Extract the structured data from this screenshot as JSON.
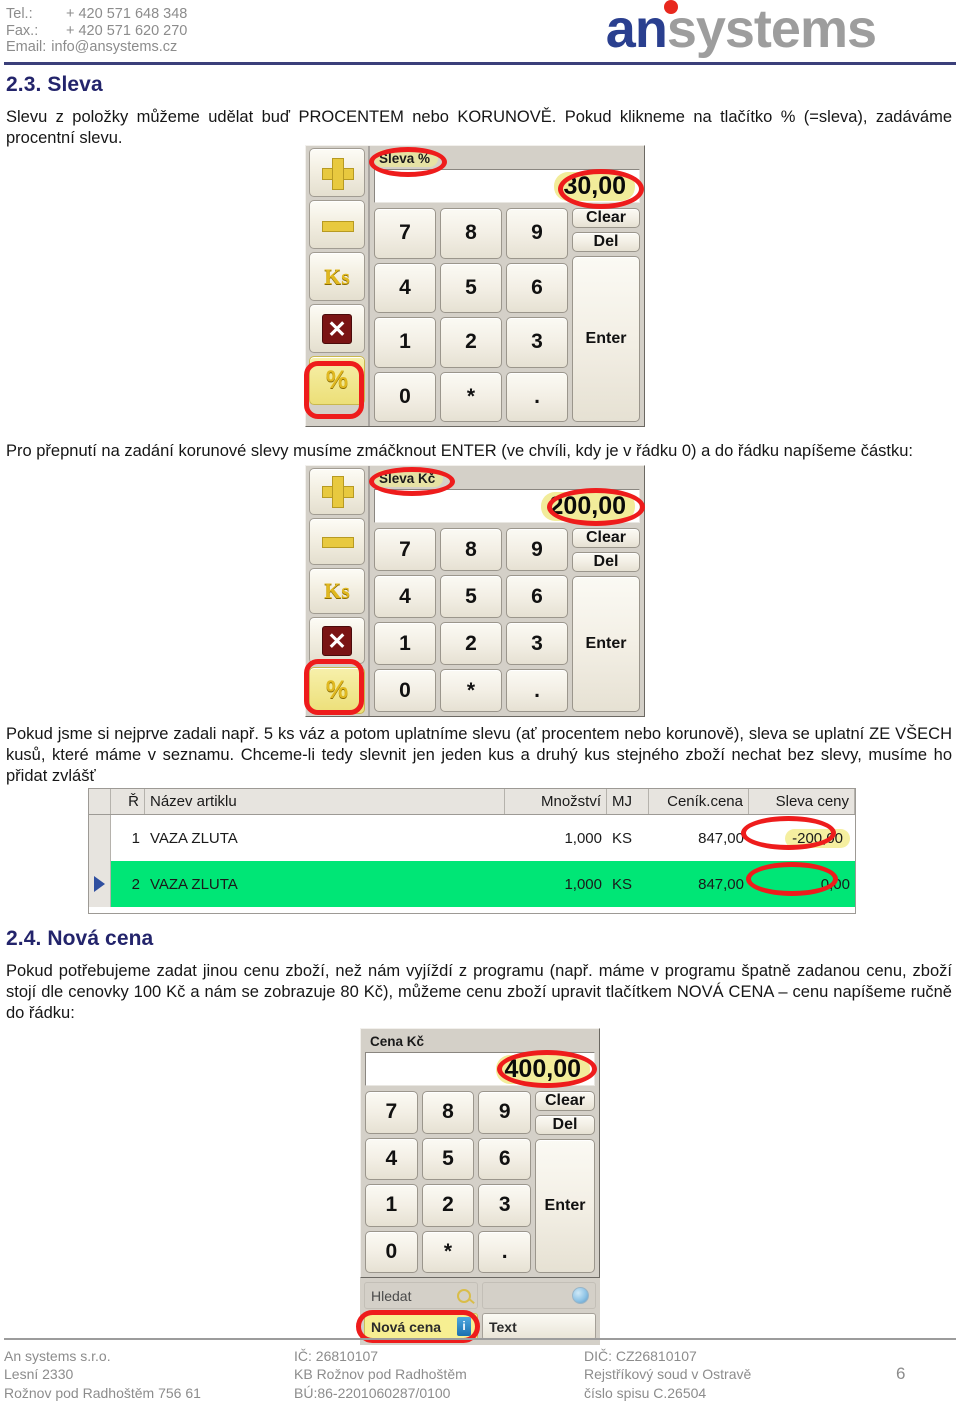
{
  "header": {
    "contact": [
      {
        "label": "Tel.:",
        "value": "+ 420 571 648 348"
      },
      {
        "label": "Fax.:",
        "value": "+ 420 571 620 270"
      },
      {
        "label": "Email:",
        "value": "info@ansystems.cz"
      }
    ],
    "logo": {
      "part1": "an",
      "part2": "systems",
      "color1": "#2a3f8f",
      "color2": "#9d9d9d",
      "dot_color": "#e8281e"
    }
  },
  "sections": [
    {
      "heading": "2.3. Sleva",
      "paragraph": "Slevu z položky můžeme udělat buď PROCENTEM nebo KORUNOVĚ. Pokud klikneme na tlačítko % (=sleva), zadáváme procentní slevu."
    },
    {
      "paragraph": "Pro přepnutí na zadání korunové slevy musíme zmáčknout ENTER (ve chvíli, kdy je v řádku 0) a do řádku napíšeme částku:"
    },
    {
      "paragraph": "Pokud jsme si nejprve zadali např. 5 ks váz a potom uplatníme slevu (ať procentem nebo korunově), sleva se uplatní ZE VŠECH kusů, které máme v seznamu. Chceme-li tedy slevnit jen jeden kus a druhý kus stejného zboží nechat bez slevy, musíme ho přidat zvlášť"
    },
    {
      "heading": "2.4. Nová cena",
      "paragraph": "Pokud potřebujeme zadat jinou cenu zboží, než nám vyjíždí z programu (např. máme v programu špatně zadanou cenu, zboží stojí dle cenovky 100 Kč a nám se zobrazuje 80 Kč), můžeme cenu zboží upravit tlačítkem NOVÁ CENA – cenu napíšeme ručně do řádku:"
    }
  ],
  "keypad_common": {
    "side_buttons": [
      {
        "name": "plus-button",
        "label": ""
      },
      {
        "name": "minus-button",
        "label": ""
      },
      {
        "name": "ks-button",
        "label": "Ks"
      },
      {
        "name": "delete-button",
        "label": "✕"
      },
      {
        "name": "percent-button",
        "label": "%"
      }
    ],
    "keys": [
      "7",
      "8",
      "9",
      "4",
      "5",
      "6",
      "1",
      "2",
      "3",
      "0",
      "*",
      "."
    ],
    "clear_label": "Clear",
    "del_label": "Del",
    "enter_label": "Enter"
  },
  "keypad_percent": {
    "title": "Sleva %",
    "value": "30,00",
    "highlight_percent": true
  },
  "keypad_czk": {
    "title": "Sleva Kč",
    "value": "200,00",
    "highlight_percent": true
  },
  "keypad_price": {
    "title": "Cena Kč",
    "value": "400,00",
    "extra_buttons": {
      "search_label": "Hledat",
      "new_price_label": "Nová cena",
      "text_label": "Text"
    }
  },
  "grid": {
    "columns": [
      "Ř",
      "Název artiklu",
      "Množství",
      "MJ",
      "Ceník.cena",
      "Sleva ceny"
    ],
    "rows": [
      {
        "r": "1",
        "name": "VAZA ZLUTA",
        "qty": "1,000",
        "mj": "KS",
        "price": "847,00",
        "discount": "-200,00",
        "selected": false,
        "highlight_discount": true
      },
      {
        "r": "2",
        "name": "VAZA ZLUTA",
        "qty": "1,000",
        "mj": "KS",
        "price": "847,00",
        "discount": "0,00",
        "selected": true,
        "highlight_discount": false
      }
    ]
  },
  "footer": {
    "col1": [
      "An systems s.r.o.",
      "Lesní 2330",
      "Rožnov pod Radhoštěm 756 61"
    ],
    "col2": [
      "IČ: 26810107",
      "KB Rožnov pod Radhoštěm",
      "BÚ:86-2201060287/0100"
    ],
    "col3": [
      "DIČ: CZ26810107",
      "Rejstříkový soud v Ostravě",
      "číslo spisu C.26504"
    ],
    "page": "6"
  }
}
